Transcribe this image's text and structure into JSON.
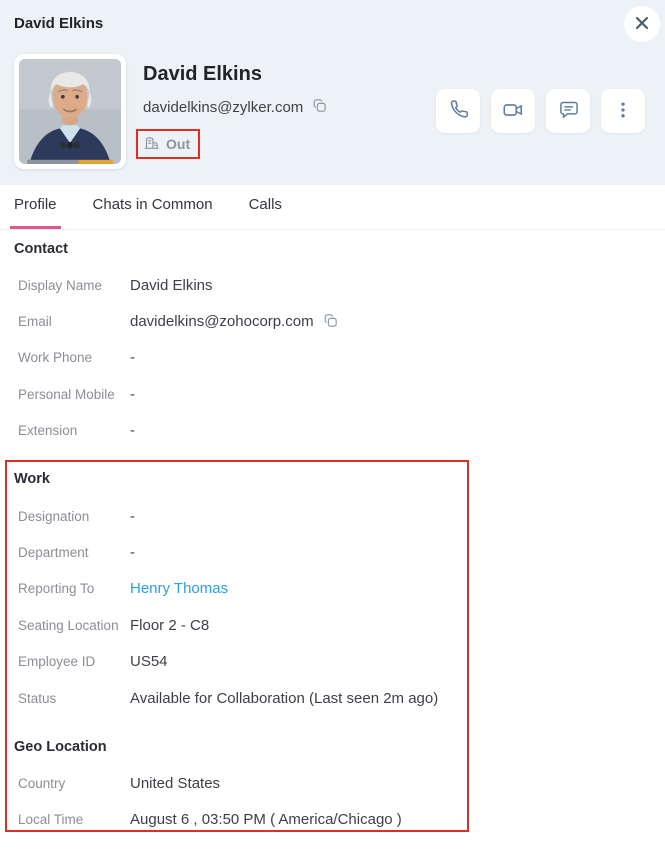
{
  "header": {
    "title": "David Elkins"
  },
  "profile": {
    "name": "David Elkins",
    "email": "davidelkins@zylker.com",
    "presence_label": "Out",
    "actions": {
      "audio_call": "phone-icon",
      "video_call": "video-camera-icon",
      "chat": "chat-bubble-icon",
      "more": "vertical-dots-icon"
    }
  },
  "tabs": {
    "profile": "Profile",
    "chats_in_common": "Chats in Common",
    "calls": "Calls",
    "active": "Profile"
  },
  "contact": {
    "heading": "Contact",
    "rows": [
      {
        "label": "Display Name",
        "value": "David Elkins"
      },
      {
        "label": "Email",
        "value": "davidelkins@zohocorp.com"
      },
      {
        "label": "Work Phone",
        "value": "-"
      },
      {
        "label": "Personal Mobile",
        "value": "-"
      },
      {
        "label": "Extension",
        "value": "-"
      }
    ]
  },
  "work": {
    "heading": "Work",
    "rows": [
      {
        "label": "Designation",
        "value": "-"
      },
      {
        "label": "Department",
        "value": "-"
      },
      {
        "label": "Reporting To",
        "value": "Henry Thomas"
      },
      {
        "label": "Seating Location",
        "value": "Floor 2 - C8"
      },
      {
        "label": "Employee ID",
        "value": "US54"
      },
      {
        "label": "Status",
        "value": "Available for Collaboration (Last seen 2m ago)"
      }
    ]
  },
  "geo": {
    "heading": "Geo Location",
    "rows": [
      {
        "label": "Country",
        "value": "United States"
      },
      {
        "label": "Local Time",
        "value": "August 6 , 03:50 PM ( America/Chicago )"
      }
    ]
  },
  "colors": {
    "hero_bg": "#edf2f6",
    "tab_accent_pink": "#e0568c",
    "link_blue": "#2f9ce3",
    "annotation_red": "#d93025",
    "icon_slate": "#5f7d9c"
  }
}
